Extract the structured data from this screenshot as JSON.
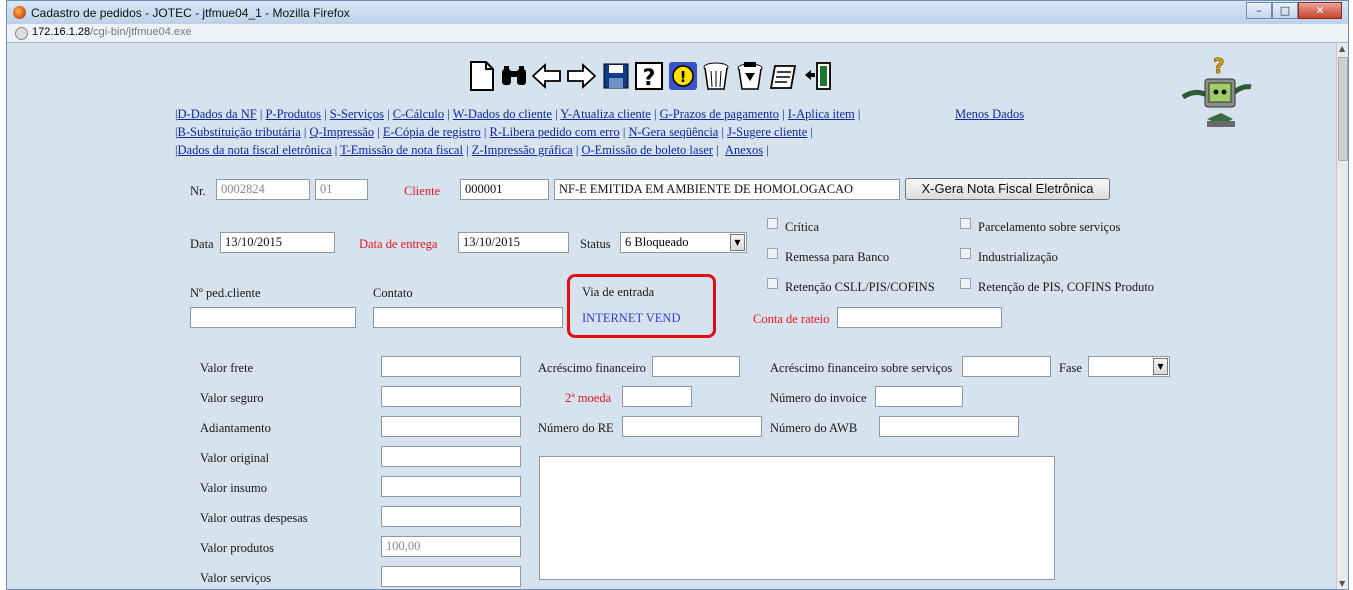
{
  "window": {
    "title": "Cadastro de pedidos - JOTEC - jtfmue04_1 - Mozilla Firefox",
    "min": "–",
    "max": "□",
    "close": "✕"
  },
  "address": {
    "host": "172.16.1.28",
    "path": "/cgi-bin/jtfmue04.exe"
  },
  "toolbar": {
    "icons": [
      "new-document-icon",
      "binoculars-search-icon",
      "arrow-left-icon",
      "arrow-right-icon",
      "save-disk-icon",
      "help-icon",
      "info-icon",
      "trash-bin-icon",
      "recycle-bin-icon",
      "notes-icon",
      "exit-door-icon"
    ],
    "assistant": "?"
  },
  "links": {
    "row1": [
      "D-Dados da NF",
      "P-Produtos",
      "S-Serviços",
      "C-Cálculo",
      "W-Dados do cliente",
      "Y-Atualiza cliente",
      "G-Prazos de pagamento",
      "I-Aplica item"
    ],
    "menos_dados": "Menos Dados",
    "row2": [
      "B-Substituição tributária",
      "Q-Impressão",
      "E-Cópia de registro",
      "R-Libera pedido com erro",
      "N-Gera seqüência",
      "J-Sugere cliente"
    ],
    "row3": [
      "Dados da nota fiscal eletrônica",
      "T-Emissão de nota fiscal",
      "Z-Impressão gráfica",
      "O-Emissão de boleto laser",
      "Anexos"
    ]
  },
  "form": {
    "nr_label": "Nr.",
    "nr_value": "0002824",
    "nr_seq": "01",
    "cliente_label": "Cliente",
    "cliente_code": "000001",
    "cliente_name": "NF-E EMITIDA EM AMBIENTE DE HOMOLOGACAO",
    "gera_nfe_button": "X-Gera Nota Fiscal Eletrônica",
    "data_label": "Data",
    "data_value": "13/10/2015",
    "data_entrega_label": "Data de entrega",
    "data_entrega_value": "13/10/2015",
    "status_label": "Status",
    "status_value": "6 Bloqueado",
    "checkboxes": {
      "critica": "Crítica",
      "parcelamento": "Parcelamento sobre serviços",
      "remessa": "Remessa para Banco",
      "industrializacao": "Industrialização",
      "retencao_csll": "Retenção CSLL/PIS/COFINS",
      "retencao_pis": "Retenção de PIS, COFINS Produto"
    },
    "ped_cliente_label": "Nº ped.cliente",
    "ped_cliente_value": "",
    "contato_label": "Contato",
    "contato_value": "",
    "via_entrada_label": "Via de entrada",
    "via_entrada_value": "INTERNET VEND",
    "conta_rateio_label": "Conta de rateio",
    "conta_rateio_value": "",
    "valor_frete": "Valor frete",
    "valor_seguro": "Valor seguro",
    "adiantamento": "Adiantamento",
    "valor_original": "Valor original",
    "valor_insumo": "Valor insumo",
    "valor_outras": "Valor outras despesas",
    "valor_produtos": "Valor produtos",
    "valor_produtos_value": "100,00",
    "valor_servicos": "Valor serviços",
    "acrescimo_fin": "Acréscimo financeiro",
    "segunda_moeda": "2ª moeda",
    "numero_re": "Número do RE",
    "acrescimo_serv": "Acréscimo financeiro sobre serviços",
    "numero_invoice": "Número do invoice",
    "numero_awb": "Número do AWB",
    "fase": "Fase",
    "fase_value": ""
  },
  "colors": {
    "background": "#d6e2ee",
    "link": "#0e2a9c",
    "required_label": "#e8181e",
    "highlight": "#e01010"
  }
}
